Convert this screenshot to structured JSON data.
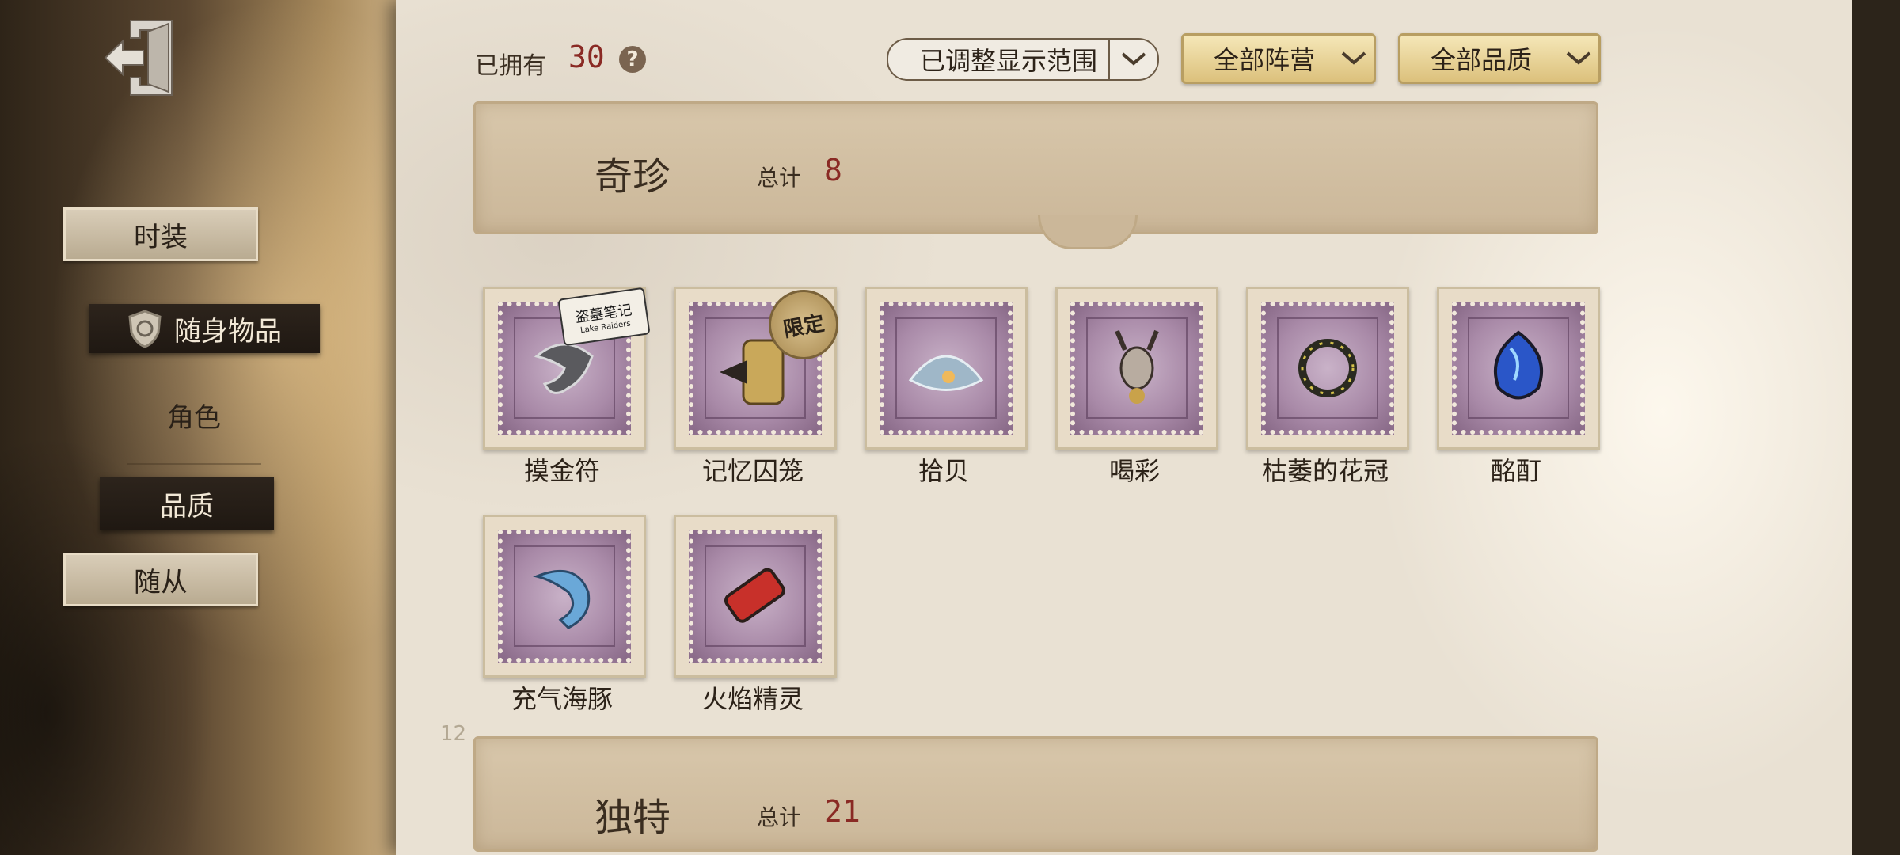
{
  "header": {
    "owned_label": "已拥有",
    "owned_count": "30",
    "help_icon": "question-icon",
    "filters": {
      "range": "已调整显示范围",
      "camp": "全部阵营",
      "quality": "全部品质"
    }
  },
  "sidebar": {
    "back_icon": "exit-door-icon",
    "items": [
      {
        "label": "时装"
      },
      {
        "label": "随身物品"
      },
      {
        "label": "角色"
      },
      {
        "label": "品质"
      },
      {
        "label": "随从"
      }
    ]
  },
  "sections": [
    {
      "title": "奇珍",
      "total_label": "总计",
      "total": "8",
      "items": [
        {
          "name": "摸金符",
          "badge": "logo",
          "badge_text": "Lake Raiders"
        },
        {
          "name": "记忆囚笼",
          "badge": "限定"
        },
        {
          "name": "拾贝"
        },
        {
          "name": "喝彩"
        },
        {
          "name": "枯萎的花冠"
        },
        {
          "name": "酩酊"
        },
        {
          "name": "充气海豚"
        },
        {
          "name": "火焰精灵"
        }
      ]
    },
    {
      "title": "独特",
      "total_label": "总计",
      "total": "21"
    }
  ],
  "page_marker": "12",
  "colors": {
    "accent_red": "#8a2a24",
    "stamp_purple": "#a98aa8",
    "gold_button": "#dcc17c"
  }
}
